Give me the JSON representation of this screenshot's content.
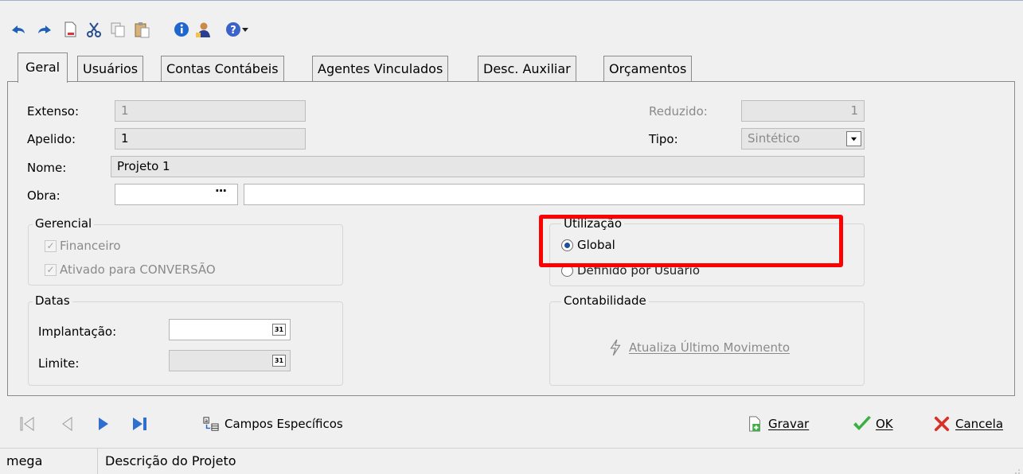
{
  "toolbar": {
    "icons": [
      "undo-icon",
      "redo-icon",
      "new-document-icon",
      "cut-icon",
      "copy-icon",
      "paste-icon",
      "info-icon",
      "user-icon",
      "help-icon",
      "dropdown-arrow-icon"
    ]
  },
  "tabs": [
    {
      "label": "Geral",
      "active": true
    },
    {
      "label": "Usuários"
    },
    {
      "label": "Contas Contábeis"
    },
    {
      "label": "Agentes Vinculados"
    },
    {
      "label": "Desc. Auxiliar"
    },
    {
      "label": "Orçamentos"
    }
  ],
  "form": {
    "extenso_label": "Extenso:",
    "extenso_value": "1",
    "apelido_label": "Apelido:",
    "apelido_value": "1",
    "nome_label": "Nome:",
    "nome_value": "Projeto 1",
    "obra_label": "Obra:",
    "obra_button": "···",
    "obra_code": "",
    "obra_desc": "",
    "reduzido_label": "Reduzido:",
    "reduzido_value": "1",
    "tipo_label": "Tipo:",
    "tipo_value": "Sintético"
  },
  "gerencial": {
    "title": "Gerencial",
    "financeiro": "Financeiro",
    "conversao": "Ativado para CONVERSÃO"
  },
  "datas": {
    "title": "Datas",
    "implantacao_label": "Implantação:",
    "implantacao_value": "",
    "limite_label": "Limite:",
    "limite_value": "",
    "calendar_glyph": "31"
  },
  "utilizacao": {
    "title": "Utilização",
    "global": "Global",
    "definido": "Definido por Usuário",
    "selected": "global"
  },
  "contabilidade": {
    "title": "Contabilidade",
    "atualiza": "Atualiza Último Movimento"
  },
  "bottom": {
    "campos": "Campos Específicos",
    "gravar": "Gravar",
    "ok": "OK",
    "cancela": "Cancela"
  },
  "status": {
    "user": "mega",
    "description": "Descrição do Projeto"
  },
  "colors": {
    "highlight": "#ff0000",
    "ok_green": "#3cb043",
    "cancel_red": "#d93025",
    "nav_blue": "#2e6fd0"
  }
}
